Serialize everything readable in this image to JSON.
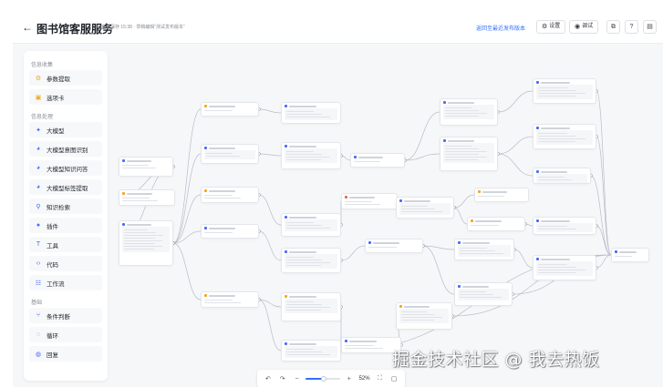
{
  "header": {
    "back_icon": "arrow-left-icon",
    "title": "图书馆客服服务",
    "save_info": "已自动保存 15:38 · 草稿编辑“测试发布版本”",
    "publish_link": "返回至最近发布版本",
    "settings_label": "设置",
    "debug_label": "调试"
  },
  "sidebar": {
    "sections": [
      {
        "title": "信息收集",
        "items": [
          {
            "label": "参数提取",
            "icon": "extract-icon",
            "color": "#f5a623"
          },
          {
            "label": "选项卡",
            "icon": "tab-icon",
            "color": "#f5a623"
          }
        ]
      },
      {
        "title": "信息处理",
        "items": [
          {
            "label": "大模型",
            "icon": "sparkle-icon",
            "color": "#4a6cf7"
          },
          {
            "label": "大模型意图识别",
            "icon": "intent-icon",
            "color": "#4a6cf7"
          },
          {
            "label": "大模型知识问答",
            "icon": "qa-icon",
            "color": "#4a6cf7"
          },
          {
            "label": "大模型标签提取",
            "icon": "tag-icon",
            "color": "#4a6cf7"
          },
          {
            "label": "知识检索",
            "icon": "search-icon",
            "color": "#4a6cf7"
          },
          {
            "label": "插件",
            "icon": "plugin-icon",
            "color": "#4a6cf7"
          },
          {
            "label": "工具",
            "icon": "tool-icon",
            "color": "#4a6cf7"
          },
          {
            "label": "代码",
            "icon": "code-icon",
            "color": "#4a6cf7"
          },
          {
            "label": "工作流",
            "icon": "workflow-icon",
            "color": "#4a6cf7"
          }
        ]
      },
      {
        "title": "基础",
        "items": [
          {
            "label": "条件判断",
            "icon": "branch-icon",
            "color": "#4a6cf7"
          },
          {
            "label": "循环",
            "icon": "loop-icon",
            "color": "#4a6cf7"
          },
          {
            "label": "回复",
            "icon": "reply-icon",
            "color": "#4a6cf7"
          }
        ]
      }
    ]
  },
  "toolbar": {
    "zoom": "52%",
    "zoom_fraction": 0.52
  },
  "watermark": "掘金技术社区 @ 我去热饭"
}
